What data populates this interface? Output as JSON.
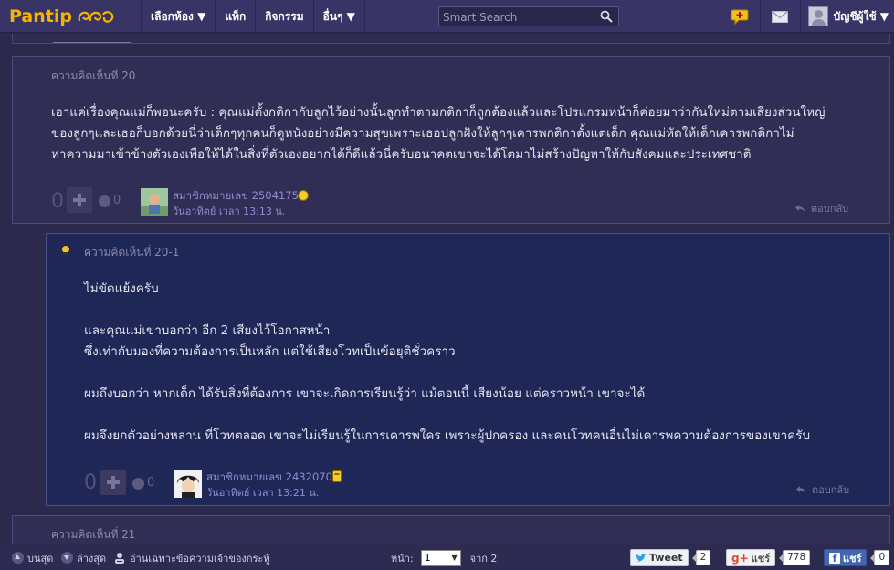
{
  "topbar": {
    "brand": "Pantip",
    "nav": [
      "เลือกห้อง ▼",
      "แท็ก",
      "กิจกรรม",
      "อื่นๆ ▼"
    ],
    "search_placeholder": "Smart Search",
    "account_label": "บัญชีผู้ใช้ ▼"
  },
  "comments": [
    {
      "label": "ความคิดเห็นที่ 20",
      "body": "เอาแค่เรื่องคุณแม่ก็พอนะครับ : คุณแม่ตั้งกติกากับลูกไว้อย่างนั้นลูกทำตามกติกาก็ถูกต้องแล้วและโปรแกรมหน้าก็ค่อยมาว่ากันใหม่ตามเสียงส่วนใหญ่\nของลูกๆและเธอก็บอกด้วยนี่ว่าเด็กๆทุกคนก็ดูหนังอย่างมีความสุขเพราะเธอปลูกฝังให้ลูกๆเคารพกติกาตั้งแต่เด็ก คุณแม่หัดให้เด็กเคารพกติกาไม่\nหาความมาเข้าข้างตัวเองเพื่อให้ได้ในสิ่งที่ตัวเองอยากได้ก็ดีแล้วนี่ครับอนาคตเขาจะได้โตมาไม่สร้างปัญหาให้กับสังคมและประเทศชาติ",
      "votes": "0",
      "emotions": "0",
      "member": "สมาชิกหมายเลข 2504175",
      "time": "วันอาทิตย์ เวลา 13:13 น.",
      "reply_label": "ตอบกลับ"
    },
    {
      "label": "ความคิดเห็นที่ 20-1",
      "lead": "ไม่ขัดแย้งครับ",
      "body": "และคุณแม่เขาบอกว่า อีก 2 เสียงไว้โอกาสหน้า\nซึ่งเท่ากับมองที่ความต้องการเป็นหลัก แต่ใช้เสียงโวทเป็นข้อยุติชั่วคราว\n\nผมถึงบอกว่า หากเด็ก ได้รับสิ่งที่ต้องการ เขาจะเกิดการเรียนรู้ว่า แม้ตอนนี้ เสียงน้อย แต่คราวหน้า เขาจะได้\n\nผมจึงยกตัวอย่างหลาน ที่โวทตลอด เขาจะไม่เรียนรู้ในการเคารพใคร เพราะผู้ปกครอง และคนโวทคนอื่นไม่เคารพความต้องการของเขาครับ",
      "votes": "0",
      "emotions": "0",
      "member": "สมาชิกหมายเลข 2432070",
      "time": "วันอาทิตย์ เวลา 13:21 น.",
      "reply_label": "ตอบกลับ"
    },
    {
      "label": "ความคิดเห็นที่ 21"
    }
  ],
  "bottombar": {
    "top_label": "บนสุด",
    "bottom_label": "ล่างสุด",
    "owner_only_label": "อ่านเฉพาะข้อความเจ้าของกระทู้",
    "page_label": "หน้า:",
    "page_value": "1",
    "page_total": "จาก 2",
    "tweet_label": "Tweet",
    "tweet_count": "2",
    "gplus_label": "แชร์",
    "gplus_count": "778",
    "fb_label": "แชร์",
    "fb_count": "0"
  }
}
